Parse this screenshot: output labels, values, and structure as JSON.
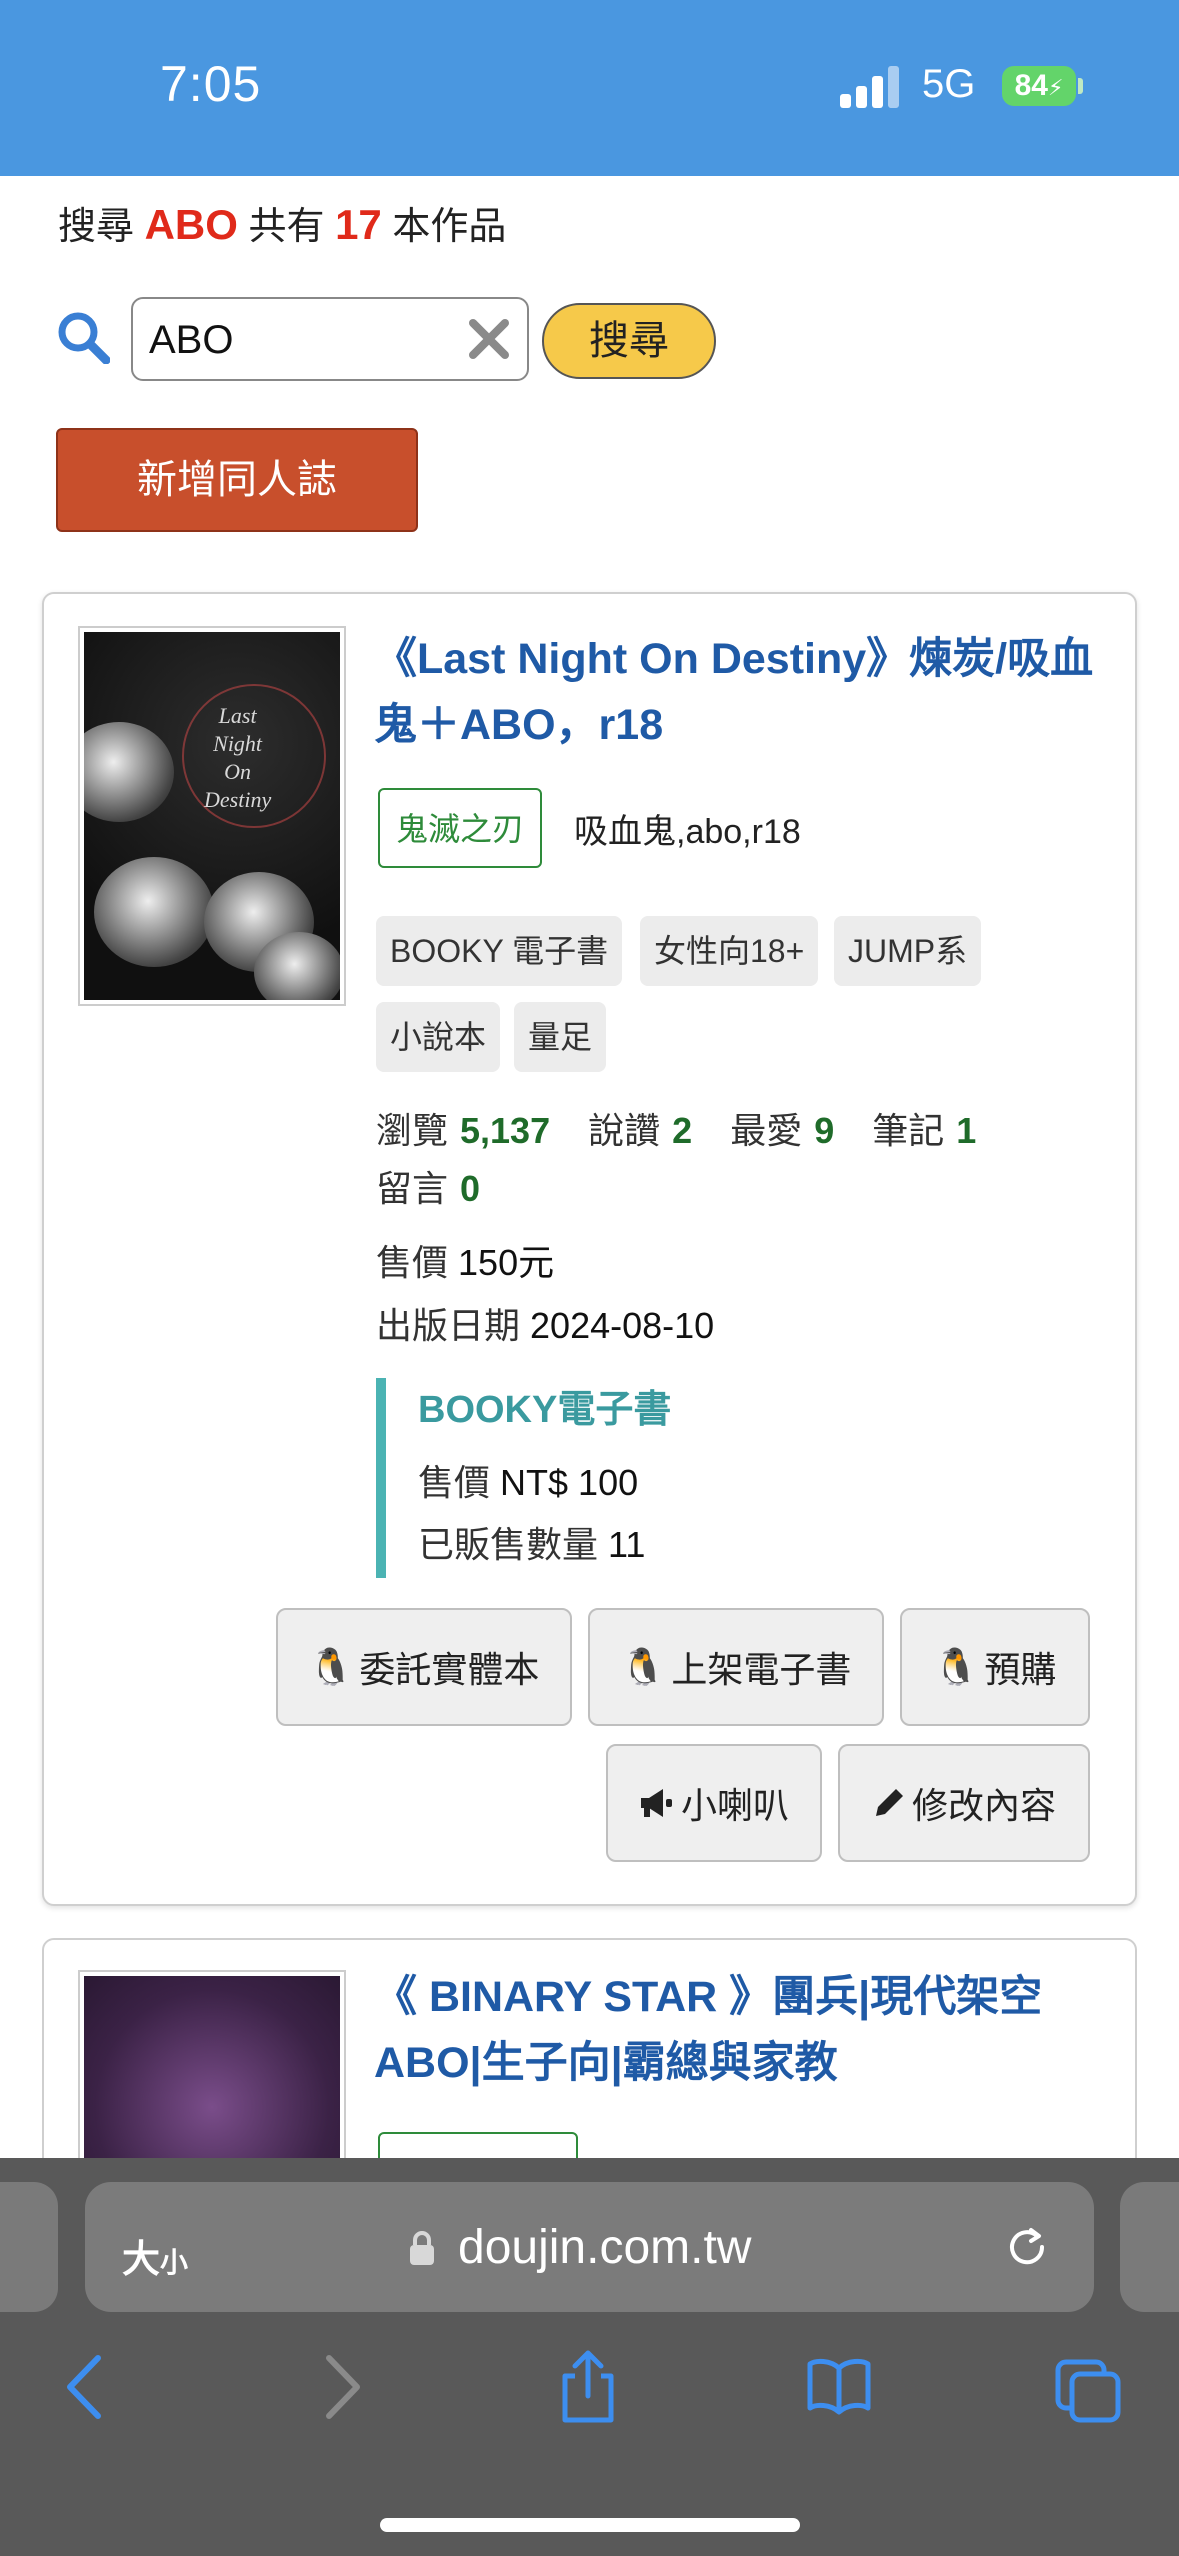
{
  "status_bar": {
    "time": "7:05",
    "network": "5G",
    "battery": "84"
  },
  "search": {
    "result_prefix": "搜尋",
    "keyword": "ABO",
    "result_mid": "共有",
    "count": "17",
    "result_suffix": "本作品",
    "input_value": "ABO",
    "button_label": "搜尋"
  },
  "new_button_label": "新增同人誌",
  "cards": [
    {
      "title": "《Last Night On Destiny》煉炭/吸血鬼＋ABO，r18",
      "cover_text": [
        "Last",
        "Night",
        "On",
        "Destiny"
      ],
      "category": "鬼滅之刃",
      "keywords": "吸血鬼,abo,r18",
      "chips": [
        "BOOKY 電子書",
        "女性向18+",
        "JUMP系",
        "小說本",
        "量足"
      ],
      "stats": {
        "views_label": "瀏覽",
        "views": "5,137",
        "comments_label": "說讚",
        "comments": "2",
        "favorites_label": "最愛",
        "favorites": "9",
        "notes_label": "筆記",
        "notes": "1",
        "messages_label": "留言",
        "messages": "0"
      },
      "price_label": "售價",
      "price": "150元",
      "date_label": "出版日期",
      "date": "2024-08-10",
      "booky": {
        "title": "BOOKY電子書",
        "price_label": "售價",
        "price": "NT$ 100",
        "sold_label": "已販售數量",
        "sold": "11"
      },
      "actions": {
        "consign": "委託實體本",
        "ebook": "上架電子書",
        "preorder": "預購",
        "trumpet": "小喇叭",
        "edit": "修改內容"
      }
    },
    {
      "title": "《 BINARY STAR 》團兵|現代架空ABO|生子向|霸總與家教"
    }
  ],
  "browser": {
    "text_size_label": "大",
    "text_size_small": "小",
    "url": "doujin.com.tw"
  },
  "colors": {
    "status_bar": "#4a97e0",
    "highlight": "#e02a1a",
    "link": "#1f5aa6",
    "tag_green": "#2e8b3a",
    "new_button": "#c84f2c",
    "search_button": "#f6c94a",
    "booky_accent": "#4bb3b3"
  }
}
